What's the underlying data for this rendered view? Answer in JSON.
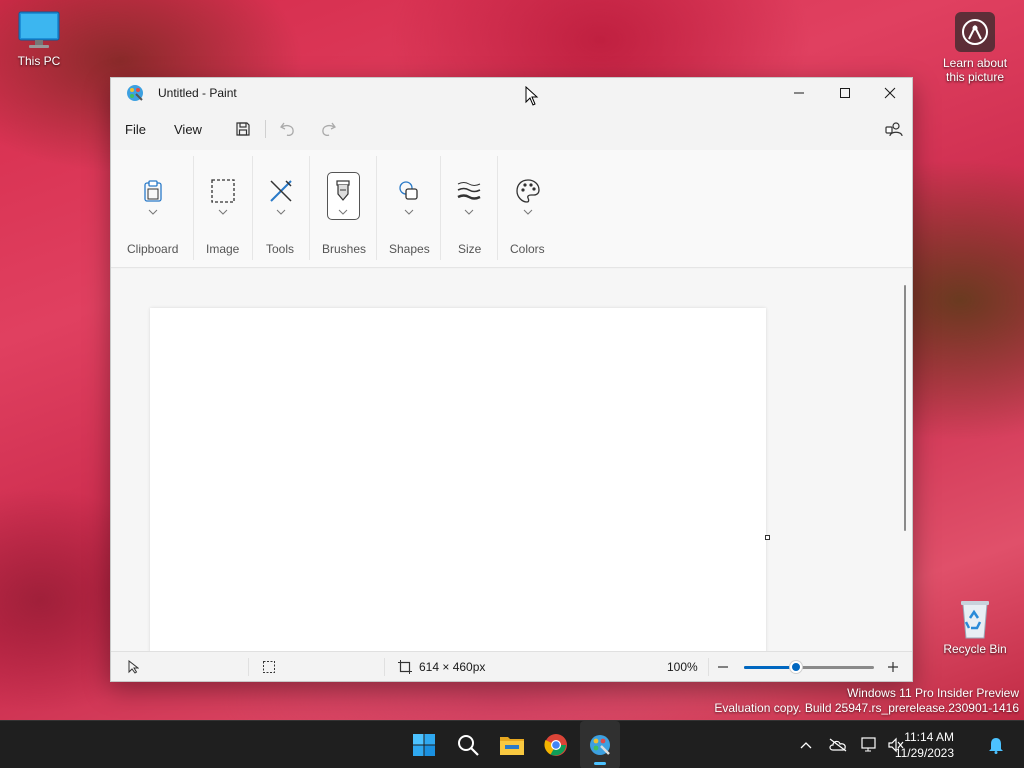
{
  "desktop": {
    "this_pc_label": "This PC",
    "learn_label": "Learn about this picture",
    "recycle_label": "Recycle Bin"
  },
  "window": {
    "title": "Untitled - Paint",
    "menu": {
      "file": "File",
      "view": "View"
    },
    "ribbon": {
      "groups": [
        {
          "label": "Clipboard",
          "icon": "clipboard-icon"
        },
        {
          "label": "Image",
          "icon": "selection-icon"
        },
        {
          "label": "Tools",
          "icon": "tools-icon"
        },
        {
          "label": "Brushes",
          "icon": "brush-icon"
        },
        {
          "label": "Shapes",
          "icon": "shapes-icon"
        },
        {
          "label": "Size",
          "icon": "stroke-size-icon"
        },
        {
          "label": "Colors",
          "icon": "palette-icon"
        }
      ]
    },
    "status": {
      "canvas_size": "614 × 460px",
      "zoom": "100%",
      "zoom_fraction": 0.4
    }
  },
  "watermark": {
    "line1": "Windows 11 Pro Insider Preview",
    "line2": "Evaluation copy. Build 25947.rs_prerelease.230901-1416"
  },
  "taskbar": {
    "time": "11:14 AM",
    "date": "11/29/2023"
  },
  "colors": {
    "accent": "#0067c0",
    "taskbar_bg": "#1f1f1f"
  }
}
